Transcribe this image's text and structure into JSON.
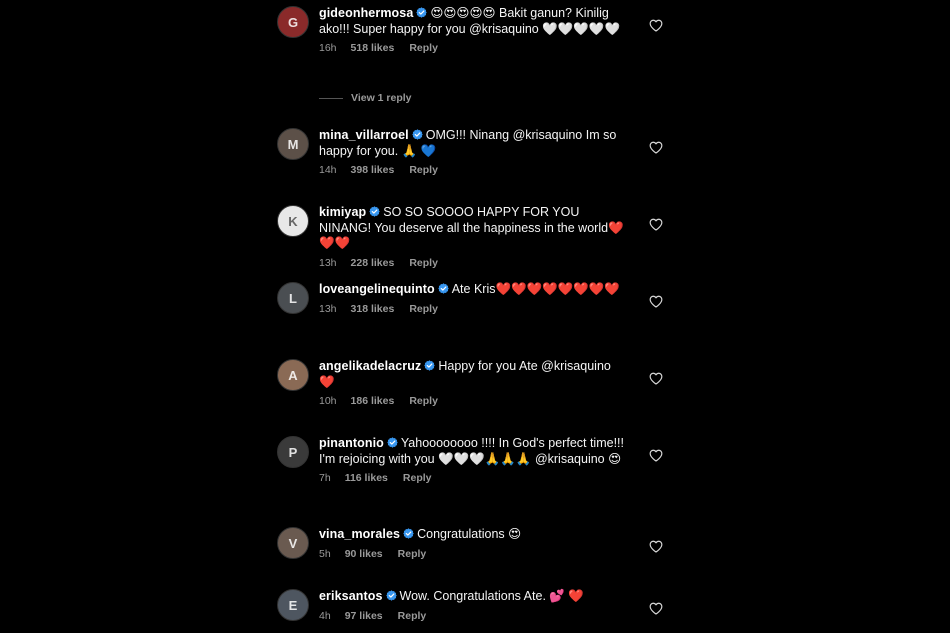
{
  "comments": [
    {
      "username": "gideonhermosa",
      "verified": true,
      "text": "😍😍😍😍😍 Bakit ganun? Kinilig ako!!! Super happy for you @krisaquino 🤍🤍🤍🤍🤍",
      "time": "16h",
      "likes": "518 likes",
      "reply_label": "Reply",
      "avatar_color": "#8a2a2a",
      "view_replies": "View 1 reply"
    },
    {
      "username": "mina_villarroel",
      "verified": true,
      "text": "OMG!!! Ninang @krisaquino  Im so happy for you. 🙏 💙",
      "time": "14h",
      "likes": "398 likes",
      "reply_label": "Reply",
      "avatar_color": "#5c5048"
    },
    {
      "username": "kimiyap",
      "verified": true,
      "text": "SO SO SOOOO HAPPY FOR YOU NINANG! You deserve all the happiness in the world❤️❤️❤️",
      "time": "13h",
      "likes": "228 likes",
      "reply_label": "Reply",
      "avatar_color": "#e8e8e8"
    },
    {
      "username": "loveangelinequinto",
      "verified": true,
      "text": "Ate Kris❤️❤️❤️❤️❤️❤️❤️❤️",
      "time": "13h",
      "likes": "318 likes",
      "reply_label": "Reply",
      "avatar_color": "#4a4e52"
    },
    {
      "username": "angelikadelacruz",
      "verified": true,
      "text": "Happy for you Ate @krisaquino ❤️",
      "time": "10h",
      "likes": "186 likes",
      "reply_label": "Reply",
      "avatar_color": "#8a6a55"
    },
    {
      "username": "pinantonio",
      "verified": true,
      "text": "Yahoooooooo !!!! In God's perfect time!!! I'm rejoicing with you 🤍🤍🤍🙏🙏🙏 @krisaquino 😍",
      "time": "7h",
      "likes": "116 likes",
      "reply_label": "Reply",
      "avatar_color": "#3a3a3a"
    },
    {
      "username": "vina_morales",
      "verified": true,
      "text": "Congratulations 😍",
      "time": "5h",
      "likes": "90 likes",
      "reply_label": "Reply",
      "avatar_color": "#6a5a50"
    },
    {
      "username": "eriksantos",
      "verified": true,
      "text": "Wow. Congratulations Ate. 💕 ❤️",
      "time": "4h",
      "likes": "97 likes",
      "reply_label": "Reply",
      "avatar_color": "#4e5660"
    }
  ],
  "icons": {
    "like": "heart-outline-icon",
    "verified": "verified-badge-icon"
  },
  "colors": {
    "background": "#000000",
    "text": "#f5f5f5",
    "muted": "#9a9a9a",
    "verified": "#3897f0"
  }
}
